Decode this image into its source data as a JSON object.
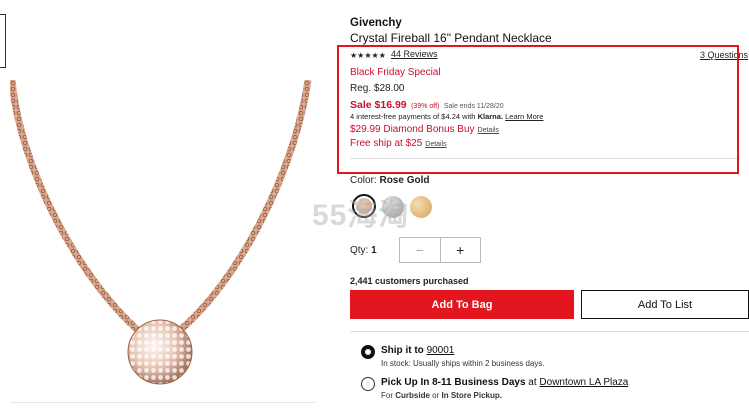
{
  "product": {
    "brand": "Givenchy",
    "title": "Crystal Fireball 16\" Pendant Necklace",
    "rating_stars": "★★★★★",
    "reviews": "44 Reviews",
    "questions": "3 Questions"
  },
  "pricing": {
    "promo": "Black Friday Special",
    "reg": "Reg. $28.00",
    "sale": "Sale $16.99",
    "sale_off": "(39% off)",
    "sale_ends": "Sale ends 11/28/20",
    "klarna_text": "4 interest-free payments of $4.24 with",
    "klarna_brand": "Klarna.",
    "learn_more": "Learn More",
    "bonus": "$29.99 Diamond Bonus Buy",
    "bonus_details": "Details",
    "free_ship": "Free ship at $25",
    "free_ship_details": "Details"
  },
  "color": {
    "label": "Color:",
    "value": "Rose Gold",
    "swatches": [
      "rose-gold",
      "silver",
      "gold"
    ]
  },
  "watermark": "55海淘",
  "quantity": {
    "label": "Qty:",
    "value": "1",
    "minus": "−",
    "plus": "+"
  },
  "purchased": "2,441 customers purchased",
  "actions": {
    "add_to_bag": "Add To Bag",
    "add_to_list": "Add To List"
  },
  "fulfillment": {
    "ship_label": "Ship it to",
    "ship_zip": "90001",
    "ship_sub": "In stock: Usually ships within 2 business days.",
    "pickup_label": "Pick Up In 8-11 Business Days",
    "pickup_at": "at",
    "pickup_store": "Downtown LA Plaza",
    "pickup_sub_pre": "For",
    "pickup_curbside": "Curbside",
    "pickup_or": "or",
    "pickup_instore": "In Store Pickup."
  },
  "colors": {
    "accent_red": "#e3151e",
    "promo_red": "#c8102e"
  }
}
